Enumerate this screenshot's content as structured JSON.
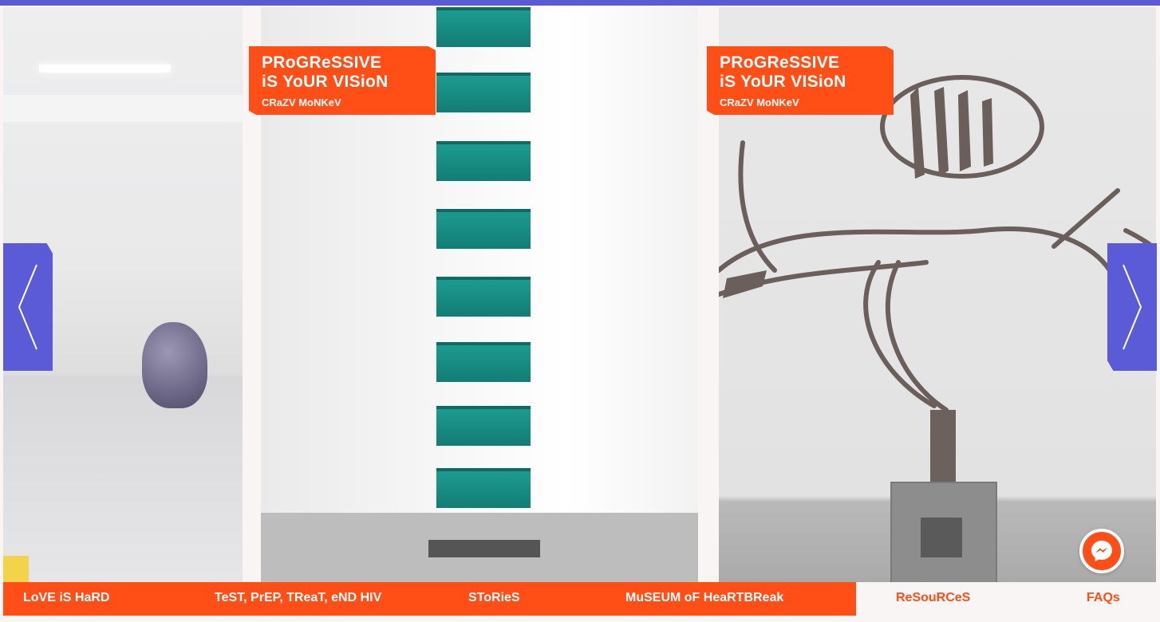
{
  "colors": {
    "accent": "#ff4e16",
    "brand_purple": "#5b5bd8",
    "text_on_accent": "#ffffff"
  },
  "carousel": {
    "slides": [
      {
        "title_line1": "PRoGReSSIVE",
        "title_line2": "iS YoUR VISioN",
        "artist": "CRaZV MoNKeV"
      },
      {
        "title_line1": "PRoGReSSIVE",
        "title_line2": "iS YoUR VISioN",
        "artist": "CRaZV MoNKeV"
      }
    ],
    "prev_icon": "chevron-left-icon",
    "next_icon": "chevron-right-icon"
  },
  "chat": {
    "icon": "messenger-icon"
  },
  "footer_nav": {
    "items": [
      {
        "label": "LoVE iS HaRD"
      },
      {
        "label": "TeST, PrEP, TReaT, eND HIV"
      },
      {
        "label": "SToRieS"
      },
      {
        "label": "MuSEUM oF HeaRTBReak"
      },
      {
        "label": "ReSouRCeS"
      },
      {
        "label": "FAQs"
      }
    ]
  }
}
